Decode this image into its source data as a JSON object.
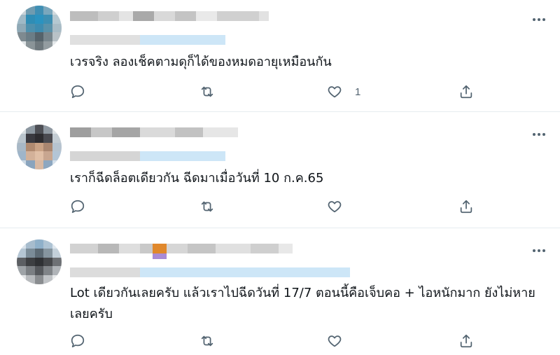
{
  "replies": [
    {
      "text": "เวรจริง ลองเช็คตามดุก็ได้ของหมดอายุเหมือนกัน",
      "reply_count": "",
      "retweet_count": "",
      "like_count": "1"
    },
    {
      "text": "เราก็ฉีดล็อตเดียวกัน ฉีดมาเมื่อวันที่ 10 ก.ค.65",
      "reply_count": "",
      "retweet_count": "",
      "like_count": ""
    },
    {
      "text": "Lot เดียวกันเลยครับ แล้วเราไปฉีดวันที่ 17/7 ตอนนี้คือเจ็บคอ + ไอหนักมาก ยังไม่หายเลยครับ",
      "reply_count": "",
      "retweet_count": "",
      "like_count": ""
    }
  ],
  "icons": {
    "reply": "reply-icon",
    "retweet": "retweet-icon",
    "like": "heart-icon",
    "share": "share-icon",
    "more": "more-options-icon"
  },
  "colors": {
    "text": "#0f1419",
    "secondary": "#536471",
    "divider": "#e6ecf0",
    "handle_blur": "#cde6f7"
  }
}
